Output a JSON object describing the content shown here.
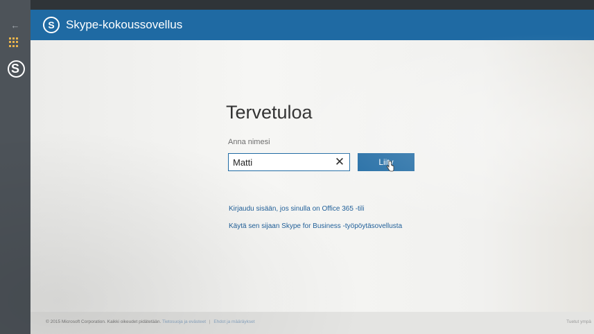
{
  "app": {
    "title": "Skype-kokoussovellus",
    "logo_letter": "S"
  },
  "browser": {
    "back_glyph": "←",
    "rail_logo_letter": "S"
  },
  "main": {
    "welcome": "Tervetuloa",
    "name_label": "Anna nimesi",
    "name_value": "Matti",
    "clear_glyph": "✕",
    "join_label": "Liity",
    "links": [
      "Kirjaudu sisään, jos sinulla on Office 365 -tili",
      "Käytä sen sijaan Skype for Business -työpöytäsovellusta"
    ]
  },
  "footer": {
    "copyright": "© 2015 Microsoft Corporation. Kaikki oikeudet pidätetään.",
    "privacy_link": "Tietosuoja ja evästeet",
    "separator": "|",
    "terms_link": "Ehdot ja määräykset",
    "right_text": "Tuetut ympä"
  },
  "colors": {
    "accent": "#1f6aa3",
    "link": "#1f5f99",
    "rail": "#4d5359"
  },
  "icons": {
    "back": "back-arrow-icon",
    "apps": "apps-grid-icon",
    "skype": "skype-logo-icon",
    "clear": "close-icon",
    "cursor": "hand-pointer-icon"
  }
}
